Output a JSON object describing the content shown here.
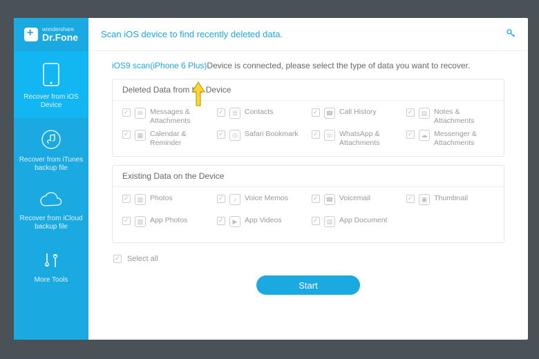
{
  "brand": {
    "top": "wondershare",
    "name": "Dr.Fone"
  },
  "sidebar": {
    "items": [
      {
        "label": "Recover from iOS Device"
      },
      {
        "label": "Recover from iTunes backup file"
      },
      {
        "label": "Recover from iCloud backup file"
      },
      {
        "label": "More Tools"
      }
    ]
  },
  "header": {
    "title": "Scan iOS device to find recently deleted data."
  },
  "scan": {
    "prefix": "iOS9 scan(",
    "device": "iPhone 6 Plus",
    "suffix": ")",
    "tail": "Device is connected, please select the type of data you want to recover."
  },
  "sections": {
    "deleted": {
      "title": "Deleted Data from the Device",
      "items": [
        "Messages & Attachments",
        "Contacts",
        "Call History",
        "Notes & Attachments",
        "Calendar & Reminder",
        "Safari Bookmark",
        "WhatsApp & Attachments",
        "Messenger & Attachments"
      ]
    },
    "existing": {
      "title": "Existing Data on the Device",
      "items": [
        "Photos",
        "Voice Memos",
        "Voicemail",
        "Thumbnail",
        "App Photos",
        "App Videos",
        "App Document"
      ]
    }
  },
  "select_all": "Select all",
  "start": "Start",
  "colors": {
    "accent": "#1aa9e0",
    "sidebar": "#1aa9e0"
  }
}
